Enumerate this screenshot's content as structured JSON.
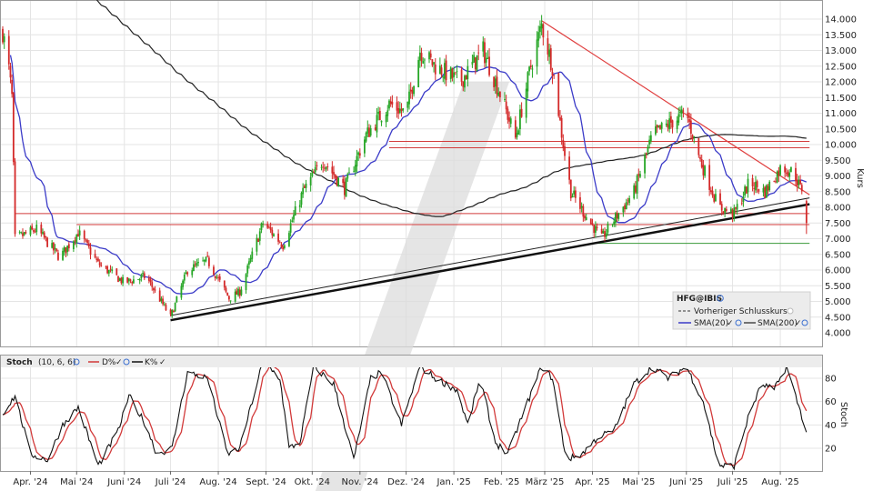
{
  "chart_data": [
    {
      "type": "candlestick",
      "symbol": "HFG@IBIS",
      "ylabel": "Kurs",
      "ylim": [
        3.6,
        14.3
      ],
      "y_ticks": [
        "4.000",
        "4.500",
        "5.000",
        "5.500",
        "6.000",
        "6.500",
        "7.000",
        "7.500",
        "8.000",
        "8.500",
        "9.000",
        "9.500",
        "10.000",
        "10.500",
        "11.000",
        "11.500",
        "12.000",
        "12.500",
        "13.000",
        "13.500",
        "14.000"
      ],
      "x_ticks": [
        "Apr. '24",
        "Mai '24",
        "Juni '24",
        "Juli '24",
        "Aug. '24",
        "Sept. '24",
        "Okt. '24",
        "Nov. '24",
        "Dez. '24",
        "Jan. '25",
        "Feb. '25",
        "März '25",
        "Apr. '25",
        "Mai '25",
        "Juni '25",
        "Juli '25",
        "Aug. '25"
      ],
      "price_anchors": [
        [
          "2024-03-14",
          13.6
        ],
        [
          "2024-03-18",
          12.4
        ],
        [
          "2024-03-20",
          11.5
        ],
        [
          "2024-03-22",
          7.0
        ],
        [
          "2024-04-05",
          7.3
        ],
        [
          "2024-04-20",
          6.4
        ],
        [
          "2024-05-02",
          7.2
        ],
        [
          "2024-05-15",
          6.2
        ],
        [
          "2024-06-01",
          5.6
        ],
        [
          "2024-06-15",
          5.8
        ],
        [
          "2024-07-01",
          4.5
        ],
        [
          "2024-07-12",
          6.0
        ],
        [
          "2024-07-25",
          6.3
        ],
        [
          "2024-08-08",
          5.1
        ],
        [
          "2024-08-15",
          5.3
        ],
        [
          "2024-08-30",
          7.5
        ],
        [
          "2024-09-12",
          6.8
        ],
        [
          "2024-09-25",
          8.5
        ],
        [
          "2024-10-08",
          9.5
        ],
        [
          "2024-10-22",
          8.6
        ],
        [
          "2024-11-05",
          10.3
        ],
        [
          "2024-11-20",
          11.3
        ],
        [
          "2024-12-01",
          11.0
        ],
        [
          "2024-12-10",
          13.0
        ],
        [
          "2024-12-20",
          12.5
        ],
        [
          "2025-01-05",
          12.0
        ],
        [
          "2025-01-20",
          13.0
        ],
        [
          "2025-02-01",
          11.5
        ],
        [
          "2025-02-10",
          10.2
        ],
        [
          "2025-02-20",
          12.5
        ],
        [
          "2025-02-27",
          13.8
        ],
        [
          "2025-03-06",
          12.5
        ],
        [
          "2025-03-13",
          10.0
        ],
        [
          "2025-03-18",
          8.5
        ],
        [
          "2025-03-28",
          7.7
        ],
        [
          "2025-04-07",
          7.0
        ],
        [
          "2025-04-15",
          7.6
        ],
        [
          "2025-04-28",
          8.5
        ],
        [
          "2025-05-10",
          10.3
        ],
        [
          "2025-05-25",
          10.8
        ],
        [
          "2025-06-01",
          11.0
        ],
        [
          "2025-06-10",
          9.5
        ],
        [
          "2025-06-22",
          8.0
        ],
        [
          "2025-07-02",
          7.8
        ],
        [
          "2025-07-12",
          8.8
        ],
        [
          "2025-07-22",
          8.5
        ],
        [
          "2025-08-02",
          9.3
        ],
        [
          "2025-08-10",
          9.1
        ],
        [
          "2025-08-14",
          8.6
        ]
      ],
      "last_session": {
        "date": "2025-08-18",
        "open": 8.2,
        "high": 8.25,
        "low": 7.15,
        "close": 7.5
      },
      "lines": {
        "sma20": {
          "name": "SMA(20)",
          "color": "#3b3bc8"
        },
        "sma200": {
          "name": "SMA(200)",
          "color": "#222222"
        },
        "prev_close": {
          "name": "Vorheriger Schlusskurs"
        }
      },
      "support_trend": {
        "p1": [
          "2024-07-01",
          4.4
        ],
        "p2": [
          "2025-08-20",
          8.1
        ]
      },
      "support_trend_inner": {
        "p1": [
          "2024-07-01",
          4.55
        ],
        "p2": [
          "2025-08-20",
          8.3
        ]
      },
      "resistance_trend": {
        "p1": [
          "2025-02-27",
          13.95
        ],
        "p2": [
          "2025-08-20",
          8.4
        ]
      },
      "horizontal_levels": [
        {
          "value": 10.1,
          "from": "2024-11-20",
          "to": "2025-08-20",
          "color": "#d23a3a"
        },
        {
          "value": 9.9,
          "from": "2024-11-20",
          "to": "2025-08-20",
          "color": "#d23a3a"
        },
        {
          "value": 7.8,
          "from": "2024-03-22",
          "to": "2025-08-20",
          "color": "#d23a3a"
        },
        {
          "value": 7.45,
          "from": "2024-05-01",
          "to": "2025-08-20",
          "color": "#d23a3a"
        },
        {
          "value": 6.85,
          "from": "2025-04-01",
          "to": "2025-08-20",
          "color": "#3a9a3a"
        }
      ],
      "legend": {
        "title": "HFG@IBIS",
        "items": [
          "Vorheriger Schlusskurs",
          "SMA(20)",
          "SMA(200)"
        ],
        "placement": "bottom-right"
      },
      "colors": {
        "up": "#26a626",
        "down": "#d42a2a",
        "grid": "#e4e4e4"
      }
    },
    {
      "type": "line",
      "title": "Stoch",
      "params": "(10, 6, 6)",
      "ylabel": "Stoch",
      "ylim": [
        0,
        100
      ],
      "y_ticks": [
        "20",
        "40",
        "60",
        "80"
      ],
      "series": [
        {
          "name": "K%",
          "color": "#111111"
        },
        {
          "name": "D%",
          "color": "#d23a3a"
        }
      ],
      "k_anchors": [
        [
          "2024-03-14",
          50
        ],
        [
          "2024-03-22",
          65
        ],
        [
          "2024-04-01",
          15
        ],
        [
          "2024-04-12",
          10
        ],
        [
          "2024-04-22",
          40
        ],
        [
          "2024-05-02",
          55
        ],
        [
          "2024-05-15",
          5
        ],
        [
          "2024-05-28",
          35
        ],
        [
          "2024-06-04",
          65
        ],
        [
          "2024-06-15",
          40
        ],
        [
          "2024-06-22",
          15
        ],
        [
          "2024-07-02",
          20
        ],
        [
          "2024-07-12",
          85
        ],
        [
          "2024-07-25",
          80
        ],
        [
          "2024-08-07",
          15
        ],
        [
          "2024-08-15",
          20
        ],
        [
          "2024-08-30",
          95
        ],
        [
          "2024-09-10",
          80
        ],
        [
          "2024-09-16",
          20
        ],
        [
          "2024-09-23",
          25
        ],
        [
          "2024-10-02",
          90
        ],
        [
          "2024-10-15",
          75
        ],
        [
          "2024-10-28",
          10
        ],
        [
          "2024-11-08",
          80
        ],
        [
          "2024-11-15",
          85
        ],
        [
          "2024-11-28",
          40
        ],
        [
          "2024-12-10",
          90
        ],
        [
          "2024-12-20",
          80
        ],
        [
          "2025-01-03",
          70
        ],
        [
          "2025-01-10",
          40
        ],
        [
          "2025-01-18",
          80
        ],
        [
          "2025-01-28",
          25
        ],
        [
          "2025-02-05",
          15
        ],
        [
          "2025-02-15",
          50
        ],
        [
          "2025-02-27",
          90
        ],
        [
          "2025-03-06",
          80
        ],
        [
          "2025-03-15",
          10
        ],
        [
          "2025-03-25",
          15
        ],
        [
          "2025-04-05",
          30
        ],
        [
          "2025-04-15",
          35
        ],
        [
          "2025-04-28",
          75
        ],
        [
          "2025-05-10",
          90
        ],
        [
          "2025-05-20",
          80
        ],
        [
          "2025-06-01",
          90
        ],
        [
          "2025-06-12",
          60
        ],
        [
          "2025-06-22",
          5
        ],
        [
          "2025-07-02",
          5
        ],
        [
          "2025-07-12",
          50
        ],
        [
          "2025-07-20",
          75
        ],
        [
          "2025-07-28",
          70
        ],
        [
          "2025-08-05",
          90
        ],
        [
          "2025-08-12",
          60
        ],
        [
          "2025-08-18",
          35
        ]
      ]
    }
  ]
}
